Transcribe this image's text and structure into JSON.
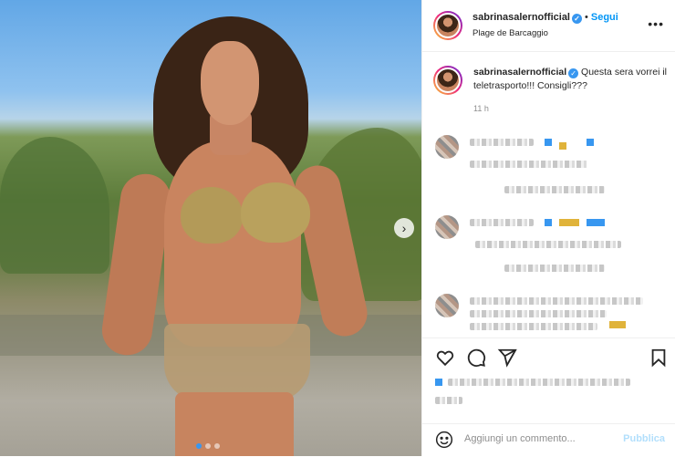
{
  "post": {
    "username": "sabrinasalernofficial",
    "follow_label": "Segui",
    "separator": "•",
    "location": "Plage de Barcaggio",
    "more_icon": "more-options-icon"
  },
  "caption": {
    "username": "sabrinasalernofficial",
    "text": "Questa sera vorrei il teletrasporto!!! Consigli???",
    "time": "11 h"
  },
  "comment_box": {
    "placeholder": "Aggiungi un commento...",
    "publish_label": "Pubblica"
  },
  "photo": {
    "next_icon": "chevron-right-icon",
    "carousel_dots": 3,
    "active_dot": 1
  },
  "colors": {
    "accent": "#0095f6",
    "verified": "#3897f0",
    "muted": "#8e8e8e",
    "publish_disabled": "#b2dffc"
  }
}
